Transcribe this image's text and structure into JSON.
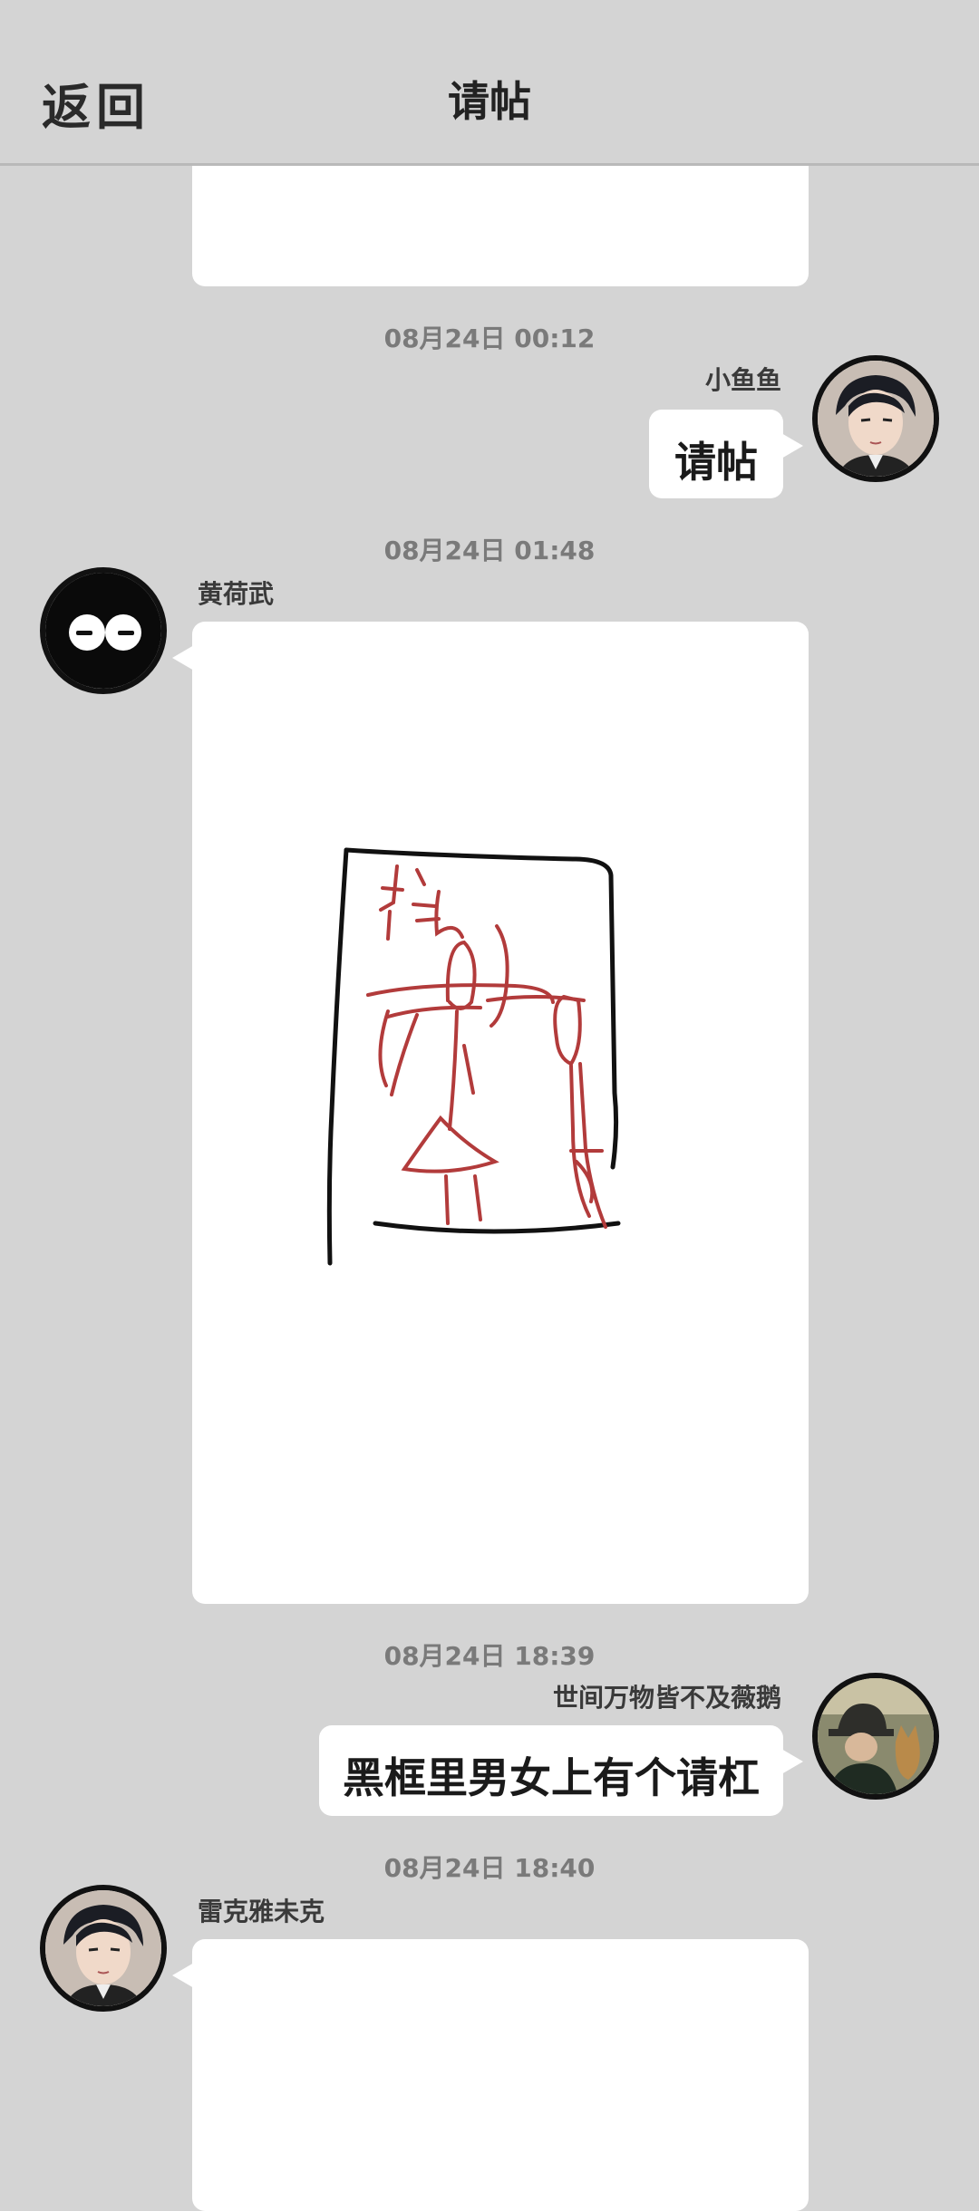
{
  "header": {
    "back_label": "返回",
    "title": "请帖"
  },
  "messages": [
    {
      "timestamp": "08月24日  00:12",
      "sender": "小鱼鱼",
      "side": "right",
      "text": "请帖",
      "avatar": "man-portrait-avatar"
    },
    {
      "timestamp": "08月24日  01:48",
      "sender": "黄荷武",
      "side": "left",
      "type": "image",
      "avatar": "black-eyes-avatar",
      "image": "hand-drawn-invitation-sketch"
    },
    {
      "timestamp": "08月24日  18:39",
      "sender": "世间万物皆不及薇鹅",
      "side": "right",
      "text": "黑框里男女上有个请杠",
      "avatar": "man-with-dog-avatar"
    },
    {
      "timestamp": "08月24日  18:40",
      "sender": "雷克雅未克",
      "side": "left",
      "type": "image",
      "avatar": "man-portrait-avatar"
    }
  ],
  "colors": {
    "background": "#d4d4d4",
    "bubble": "#ffffff",
    "drawing_red": "#b23b3b"
  }
}
